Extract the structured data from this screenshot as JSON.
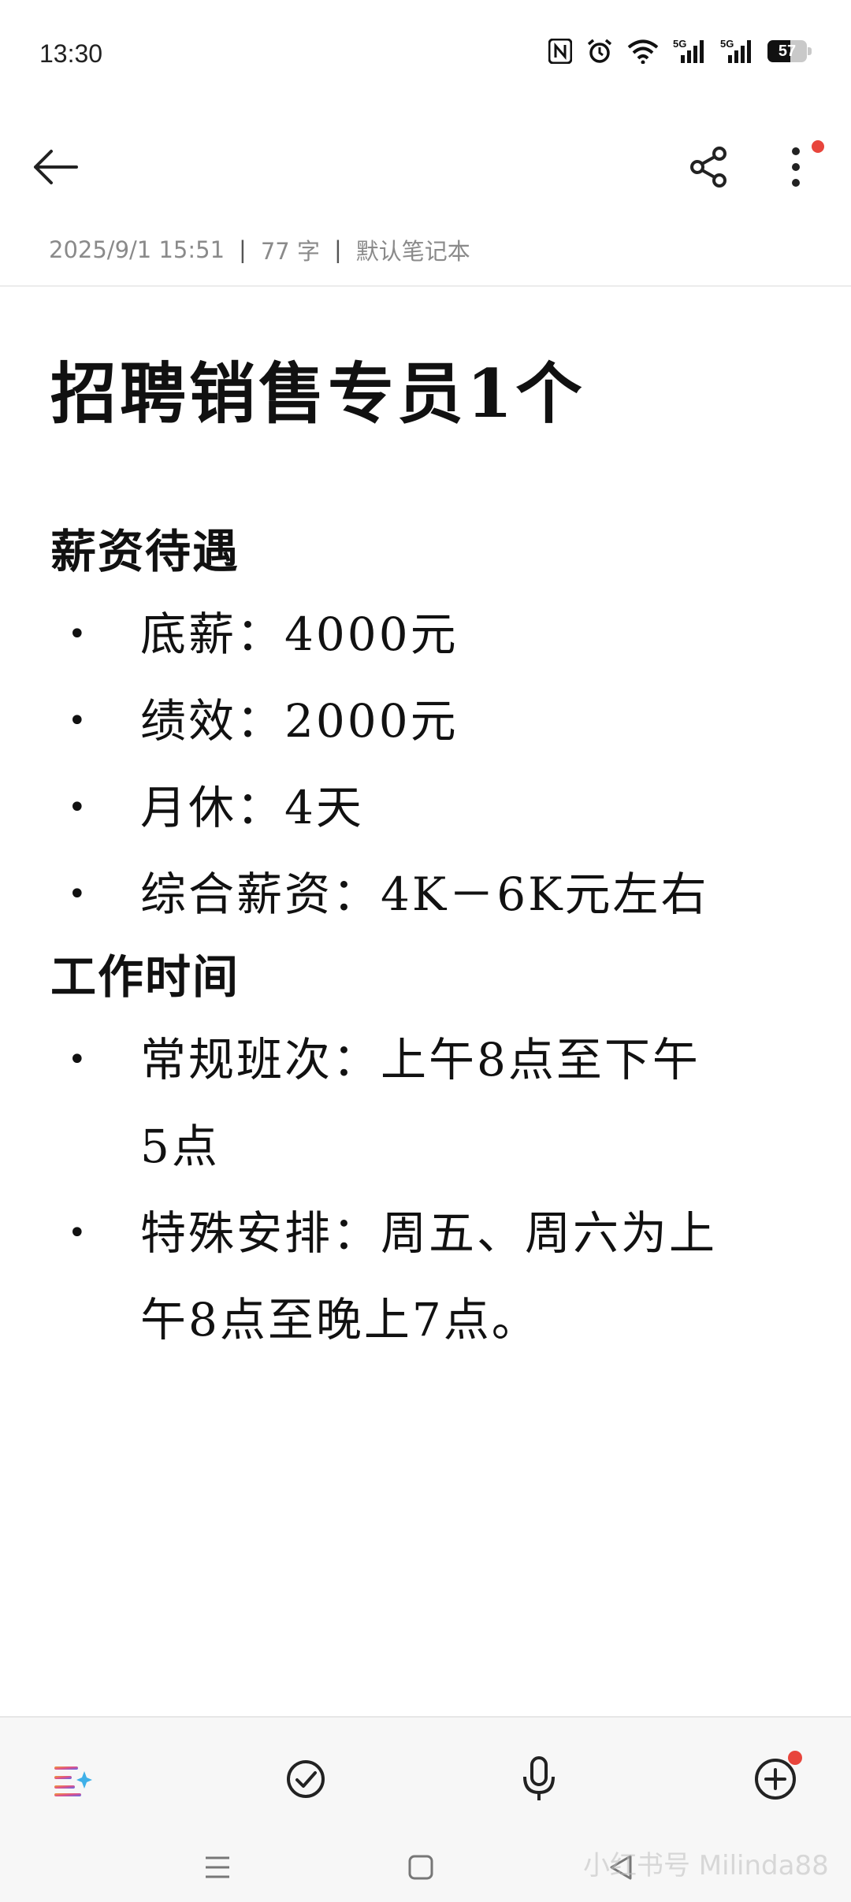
{
  "status_bar": {
    "time": "13:30",
    "battery": "57",
    "battery_level": 0.57,
    "icons": [
      "nfc-icon",
      "alarm-icon",
      "wifi-icon",
      "signal-5g-icon",
      "signal-5g-icon",
      "battery-icon"
    ]
  },
  "toolbar": {
    "icons": [
      "back-arrow-icon",
      "share-icon",
      "more-vertical-icon"
    ],
    "notification_dot_color": "#e8453c"
  },
  "meta": {
    "datetime": "2025/9/1 15:51",
    "separator": "|",
    "word_count": "77 字",
    "notebook": "默认笔记本"
  },
  "note": {
    "title": "招聘销售专员1个",
    "sections": [
      {
        "heading": "薪资待遇",
        "items": [
          "底薪：4000元",
          "绩效：2000元",
          "月休：4天",
          "综合薪资：4K－6K元左右"
        ]
      },
      {
        "heading": "工作时间",
        "items": [
          "常规班次：上午8点至下午5点",
          "特殊安排：周五、周六为上午8点至晚上7点。"
        ]
      }
    ],
    "bullet": "•"
  },
  "bottom_bar": {
    "icons": [
      "ai-list-icon",
      "checkbox-icon",
      "microphone-icon",
      "add-icon"
    ],
    "nav_icons": [
      "menu-icon",
      "home-icon",
      "back-icon"
    ]
  },
  "watermark": "小红书号 Milinda88"
}
